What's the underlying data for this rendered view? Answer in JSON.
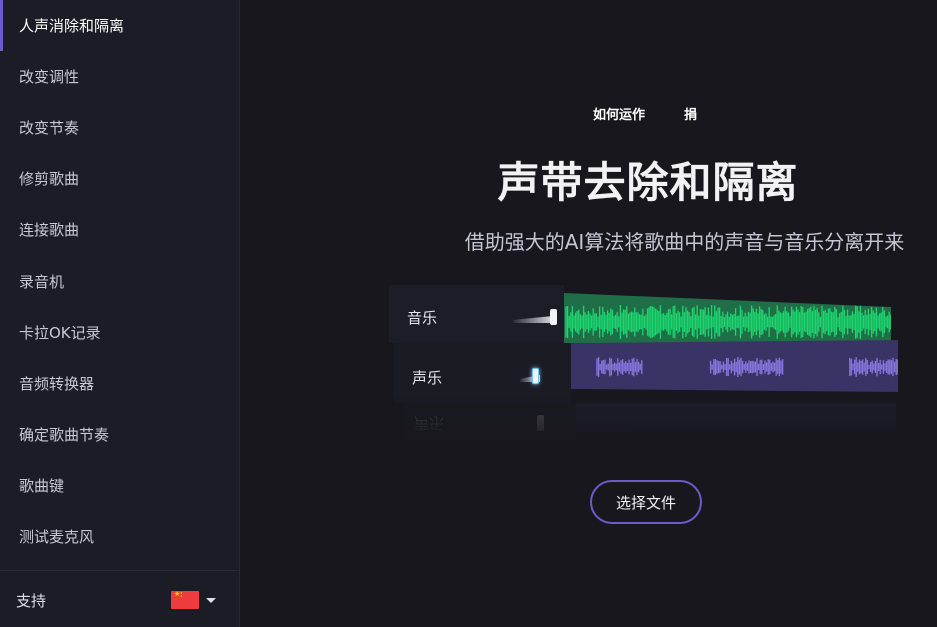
{
  "sidebar": {
    "items": [
      {
        "label": "人声消除和隔离",
        "active": true
      },
      {
        "label": "改变调性"
      },
      {
        "label": "改变节奏"
      },
      {
        "label": "修剪歌曲"
      },
      {
        "label": "连接歌曲"
      },
      {
        "label": "录音机"
      },
      {
        "label": "卡拉OK记录"
      },
      {
        "label": "音频转换器"
      },
      {
        "label": "确定歌曲节奏"
      },
      {
        "label": "歌曲键"
      },
      {
        "label": "测试麦克风"
      }
    ],
    "footer": {
      "support_label": "支持",
      "language_flag": "china-flag-icon"
    }
  },
  "header": {
    "links": [
      "如何运作",
      "捐"
    ]
  },
  "hero": {
    "title": "声带去除和隔离",
    "subtitle": "借助强大的AI算法将歌曲中的声音与音乐分离开来"
  },
  "mixer": {
    "tracks": [
      {
        "label": "音乐",
        "volume": 0.9,
        "color": "#1ed66f",
        "bg": "#1f6e47"
      },
      {
        "label": "声乐",
        "volume": 0.35,
        "color": "#8a78e0",
        "bg": "#3a3466"
      }
    ]
  },
  "actions": {
    "select_file_label": "选择文件"
  },
  "colors": {
    "accent": "#6c5cc9",
    "background": "#17171d",
    "sidebar": "#1c1c26"
  }
}
